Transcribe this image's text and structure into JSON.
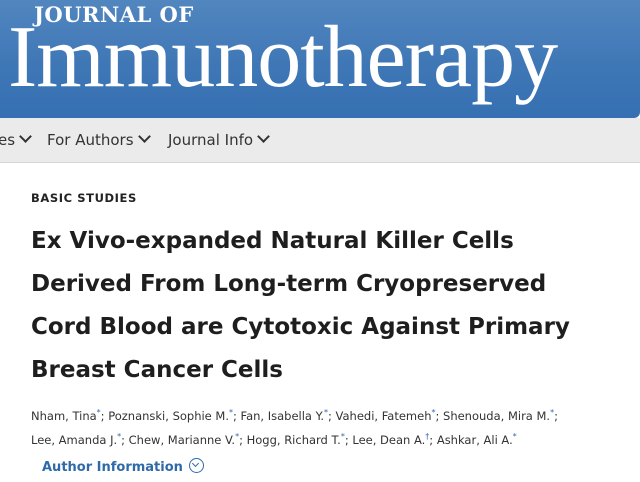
{
  "masthead": {
    "journal_prefix": "JOURNAL OF",
    "journal_name": "Immunotherapy"
  },
  "nav": {
    "items": [
      {
        "label": "es"
      },
      {
        "label": "For Authors"
      },
      {
        "label": "Journal Info"
      }
    ]
  },
  "article": {
    "section": "BASIC STUDIES",
    "title_lines": [
      "Ex Vivo-expanded Natural Killer Cells",
      "Derived From Long-term Cryopreserved",
      "Cord Blood are Cytotoxic Against Primary",
      "Breast Cancer Cells"
    ],
    "authors": [
      {
        "name": "Nham, Tina",
        "mark": "*"
      },
      {
        "name": "Poznanski, Sophie M.",
        "mark": "*"
      },
      {
        "name": "Fan, Isabella Y.",
        "mark": "*"
      },
      {
        "name": "Vahedi, Fatemeh",
        "mark": "*"
      },
      {
        "name": "Shenouda, Mira M.",
        "mark": "*"
      },
      {
        "name": "Lee, Amanda J.",
        "mark": "*"
      },
      {
        "name": "Chew, Marianne V.",
        "mark": "*"
      },
      {
        "name": "Hogg, Richard T.",
        "mark": "*"
      },
      {
        "name": "Lee, Dean A.",
        "mark": "†"
      },
      {
        "name": "Ashkar, Ali A.",
        "mark": "*"
      }
    ],
    "author_info_label": "Author Information"
  },
  "colors": {
    "masthead_blue": "#3f77b6",
    "link_blue": "#2f6aa8",
    "nav_background": "#ebebeb"
  }
}
